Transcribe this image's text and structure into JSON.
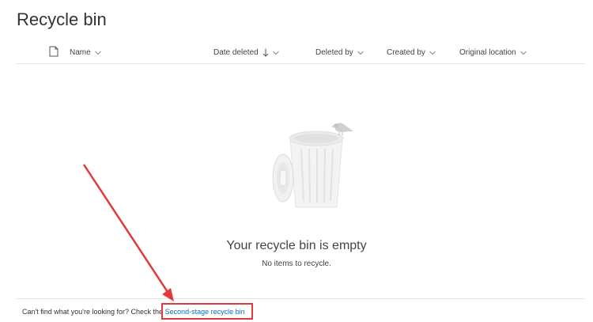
{
  "page": {
    "title": "Recycle bin"
  },
  "columns": {
    "name": "Name",
    "date_deleted": "Date deleted",
    "deleted_by": "Deleted by",
    "created_by": "Created by",
    "original_location": "Original location"
  },
  "empty_state": {
    "title": "Your recycle bin is empty",
    "subtitle": "No items to recycle."
  },
  "footer": {
    "prompt": "Can't find what you're looking for? Check the",
    "link": "Second-stage recycle bin"
  },
  "colors": {
    "link": "#0f6cbd",
    "annotation": "#e23a3a"
  }
}
